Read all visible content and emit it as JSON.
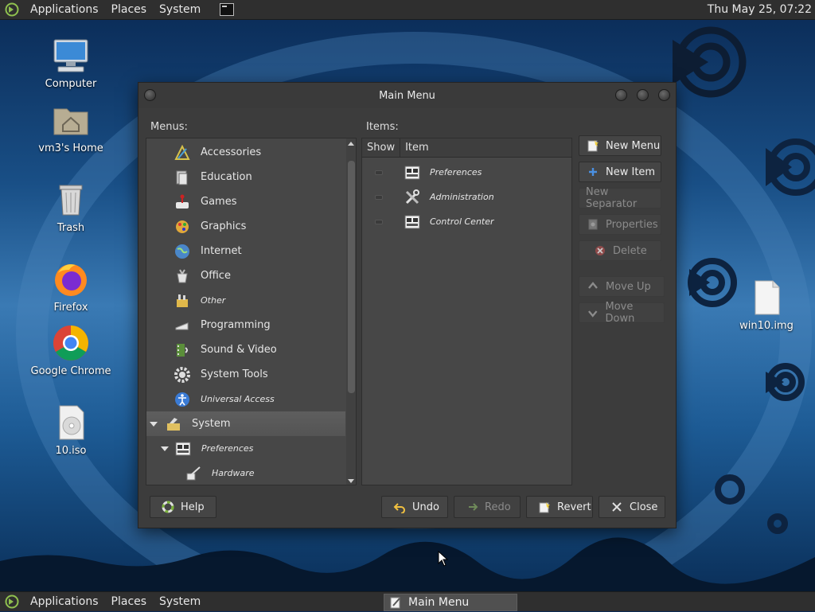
{
  "top_panel": {
    "menus": [
      "Applications",
      "Places",
      "System"
    ],
    "clock": "Thu May 25, 07:22"
  },
  "bottom_panel": {
    "menus": [
      "Applications",
      "Places",
      "System"
    ],
    "task_label": "Main Menu"
  },
  "desktop": {
    "icons": [
      {
        "label": "Computer",
        "icon": "computer-icon"
      },
      {
        "label": "vm3's Home",
        "icon": "home-folder-icon"
      },
      {
        "label": "Trash",
        "icon": "trash-icon"
      },
      {
        "label": "Firefox",
        "icon": "firefox-icon"
      },
      {
        "label": "Google Chrome",
        "icon": "chrome-icon"
      },
      {
        "label": "10.iso",
        "icon": "disc-image-icon"
      },
      {
        "label": "win10.img",
        "icon": "file-icon"
      }
    ]
  },
  "window": {
    "title": "Main Menu",
    "menus_label": "Menus:",
    "items_label": "Items:",
    "menus": [
      {
        "label": "Accessories",
        "icon": "accessories-icon"
      },
      {
        "label": "Education",
        "icon": "education-icon"
      },
      {
        "label": "Games",
        "icon": "games-icon"
      },
      {
        "label": "Graphics",
        "icon": "graphics-icon"
      },
      {
        "label": "Internet",
        "icon": "internet-icon"
      },
      {
        "label": "Office",
        "icon": "office-icon"
      },
      {
        "label": "Other",
        "icon": "other-icon"
      },
      {
        "label": "Programming",
        "icon": "programming-icon"
      },
      {
        "label": "Sound & Video",
        "icon": "sound-video-icon"
      },
      {
        "label": "System Tools",
        "icon": "system-tools-icon"
      },
      {
        "label": "Universal Access",
        "icon": "universal-access-icon"
      },
      {
        "label": "System",
        "icon": "system-icon"
      },
      {
        "label": "Preferences",
        "icon": "preferences-icon"
      },
      {
        "label": "Hardware",
        "icon": "hardware-icon"
      }
    ],
    "items_columns": {
      "show": "Show",
      "item": "Item"
    },
    "items": [
      {
        "label": "Preferences",
        "icon": "preferences-icon"
      },
      {
        "label": "Administration",
        "icon": "administration-icon"
      },
      {
        "label": "Control Center",
        "icon": "control-center-icon"
      }
    ],
    "side_buttons": {
      "new_menu": "New Menu",
      "new_item": "New Item",
      "new_separator": "New Separator",
      "properties": "Properties",
      "delete": "Delete",
      "move_up": "Move Up",
      "move_down": "Move Down"
    },
    "bottom_buttons": {
      "help": "Help",
      "undo": "Undo",
      "redo": "Redo",
      "revert": "Revert",
      "close": "Close"
    },
    "colors": {
      "window_bg": "#3c3c3c",
      "pane_bg": "#474747",
      "selected_row": "#5a5a5a"
    }
  }
}
